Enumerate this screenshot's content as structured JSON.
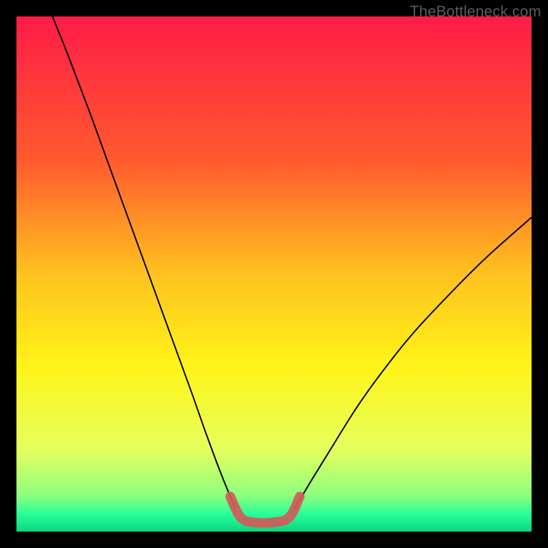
{
  "attribution": "TheBottleneck.com",
  "chart_data": {
    "type": "line",
    "title": "",
    "xlabel": "",
    "ylabel": "",
    "xlim": [
      0,
      100
    ],
    "ylim": [
      0,
      100
    ],
    "gradient_stops": [
      {
        "offset": 0.0,
        "color": "#ff1c47"
      },
      {
        "offset": 0.28,
        "color": "#ff5a2e"
      },
      {
        "offset": 0.5,
        "color": "#ffc21f"
      },
      {
        "offset": 0.68,
        "color": "#fff419"
      },
      {
        "offset": 0.84,
        "color": "#e7ff5e"
      },
      {
        "offset": 0.93,
        "color": "#8dff7e"
      },
      {
        "offset": 0.965,
        "color": "#2bff9a"
      },
      {
        "offset": 1.0,
        "color": "#09d77f"
      }
    ],
    "series": [
      {
        "name": "left-curve",
        "stroke": "#000000",
        "values": [
          {
            "x": 7.0,
            "y": 100.0
          },
          {
            "x": 10.0,
            "y": 92.5
          },
          {
            "x": 14.0,
            "y": 82.0
          },
          {
            "x": 18.0,
            "y": 71.0
          },
          {
            "x": 22.0,
            "y": 60.0
          },
          {
            "x": 26.0,
            "y": 49.0
          },
          {
            "x": 30.0,
            "y": 38.0
          },
          {
            "x": 34.0,
            "y": 27.0
          },
          {
            "x": 37.0,
            "y": 18.5
          },
          {
            "x": 40.0,
            "y": 10.5
          },
          {
            "x": 42.5,
            "y": 4.5
          }
        ]
      },
      {
        "name": "right-curve",
        "stroke": "#000000",
        "values": [
          {
            "x": 54.0,
            "y": 4.5
          },
          {
            "x": 57.0,
            "y": 9.5
          },
          {
            "x": 61.0,
            "y": 16.0
          },
          {
            "x": 66.0,
            "y": 24.0
          },
          {
            "x": 71.0,
            "y": 31.0
          },
          {
            "x": 77.0,
            "y": 38.5
          },
          {
            "x": 84.0,
            "y": 46.0
          },
          {
            "x": 91.0,
            "y": 53.0
          },
          {
            "x": 100.0,
            "y": 61.0
          }
        ]
      },
      {
        "name": "zone-marker",
        "stroke": "#d15a5a",
        "values": [
          {
            "x": 41.5,
            "y": 6.8
          },
          {
            "x": 43.5,
            "y": 2.8
          },
          {
            "x": 46.0,
            "y": 1.8
          },
          {
            "x": 50.0,
            "y": 1.8
          },
          {
            "x": 53.0,
            "y": 2.8
          },
          {
            "x": 55.0,
            "y": 6.8
          }
        ]
      }
    ]
  }
}
